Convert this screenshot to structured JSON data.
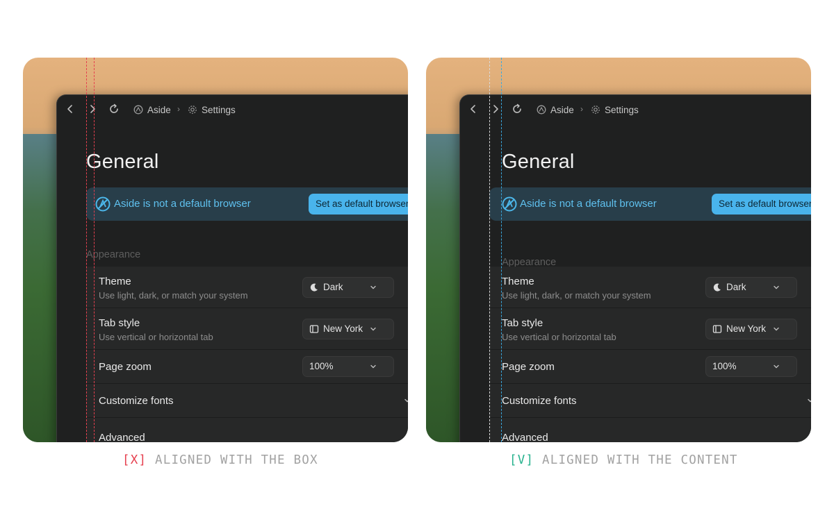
{
  "panels": [
    {
      "id": "left",
      "breadcrumb": {
        "app": "Aside",
        "page": "Settings"
      },
      "title": "General",
      "banner": {
        "text": "Aside is not a default browser",
        "button": "Set as default browser"
      },
      "section": "Appearance",
      "rows": [
        {
          "label": "Theme",
          "sub": "Use light, dark, or match your system",
          "value": "Dark",
          "icon": "moon-icon"
        },
        {
          "label": "Tab style",
          "sub": "Use vertical or horizontal tab",
          "value": "New York",
          "icon": "sidebar-layout-icon"
        },
        {
          "label": "Page zoom",
          "value": "100%"
        },
        {
          "label": "Customize fonts"
        },
        {
          "label": "Advanced"
        }
      ],
      "guide_color": "#e6404f"
    },
    {
      "id": "right",
      "breadcrumb": {
        "app": "Aside",
        "page": "Settings"
      },
      "title": "General",
      "banner": {
        "text": "Aside is not a default browser",
        "button": "Set as default browser"
      },
      "section": "Appearance",
      "rows": [
        {
          "label": "Theme",
          "sub": "Use light, dark, or match your system",
          "value": "Dark",
          "icon": "moon-icon"
        },
        {
          "label": "Tab style",
          "sub": "Use vertical or horizontal tab",
          "value": "New York",
          "icon": "sidebar-layout-icon"
        },
        {
          "label": "Page zoom",
          "value": "100%"
        },
        {
          "label": "Customize fonts"
        },
        {
          "label": "Advanced"
        }
      ],
      "guide_color": "#39a9e0"
    }
  ],
  "captions": {
    "left": {
      "mark": "[X]",
      "text": "ALIGNED WITH THE BOX",
      "mark_color": "#e6404f"
    },
    "right": {
      "mark": "[V]",
      "text": "ALIGNED WITH THE CONTENT",
      "mark_color": "#27b28e"
    }
  }
}
